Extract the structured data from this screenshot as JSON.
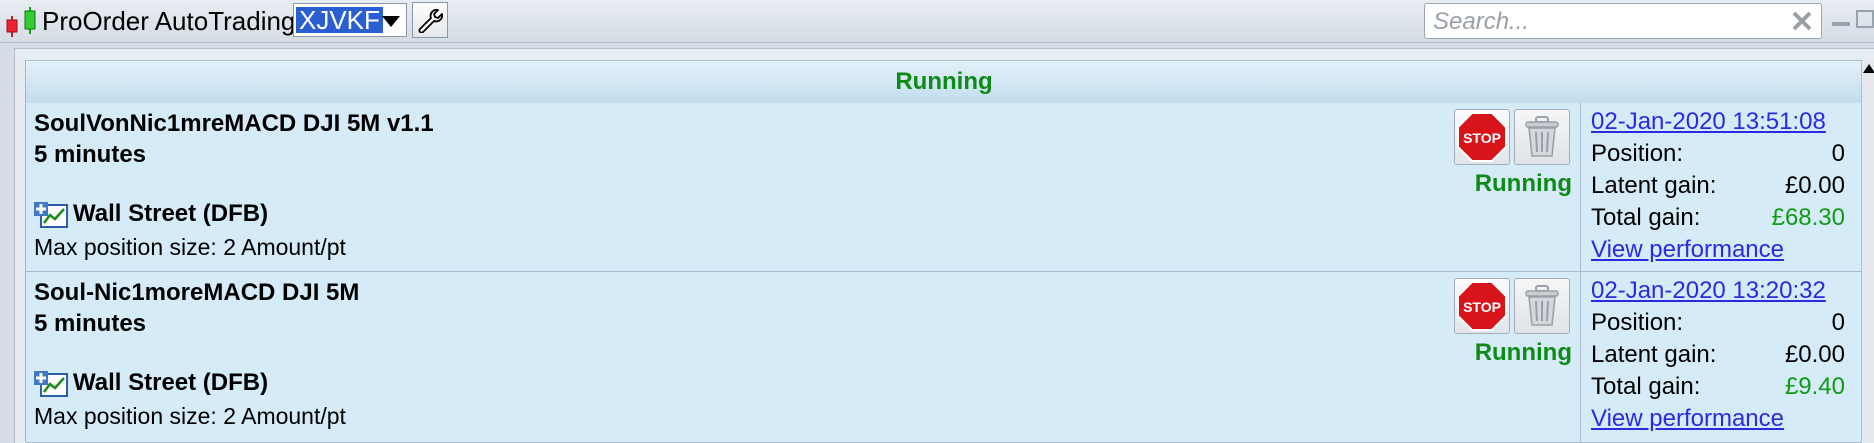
{
  "app": {
    "title": "ProOrder AutoTrading",
    "account": "XJVKF",
    "logo_icon": "candlestick-icon",
    "settings_icon": "wrench-icon"
  },
  "search": {
    "placeholder": "Search...",
    "value": ""
  },
  "section": {
    "header": "Running"
  },
  "systems": [
    {
      "name": "SoulVonNic1mreMACD DJI 5M v1.1",
      "period": "5 minutes",
      "instrument": "Wall Street (DFB)",
      "max_position": "Max position size: 2 Amount/pt",
      "status": "Running",
      "start_date": "02-Jan-2020 13:51:08",
      "position_label": "Position:",
      "position_value": "0",
      "latent_label": "Latent gain:",
      "latent_value": "£0.00",
      "total_label": "Total gain:",
      "total_value": "£68.30",
      "performance_link": "View performance",
      "stop_label": "STOP"
    },
    {
      "name": "Soul-Nic1moreMACD DJI 5M",
      "period": "5 minutes",
      "instrument": "Wall Street (DFB)",
      "max_position": "Max position size: 2 Amount/pt",
      "status": "Running",
      "start_date": "02-Jan-2020 13:20:32",
      "position_label": "Position:",
      "position_value": "0",
      "latent_label": "Latent gain:",
      "latent_value": "£0.00",
      "total_label": "Total gain:",
      "total_value": "£9.40",
      "performance_link": "View performance",
      "stop_label": "STOP"
    }
  ],
  "colors": {
    "running_green": "#0f8a16",
    "gain_green": "#119a14",
    "link_blue": "#2a2ae0",
    "row_bg": "#d5ecf8",
    "account_highlight": "#2a5fd4"
  }
}
